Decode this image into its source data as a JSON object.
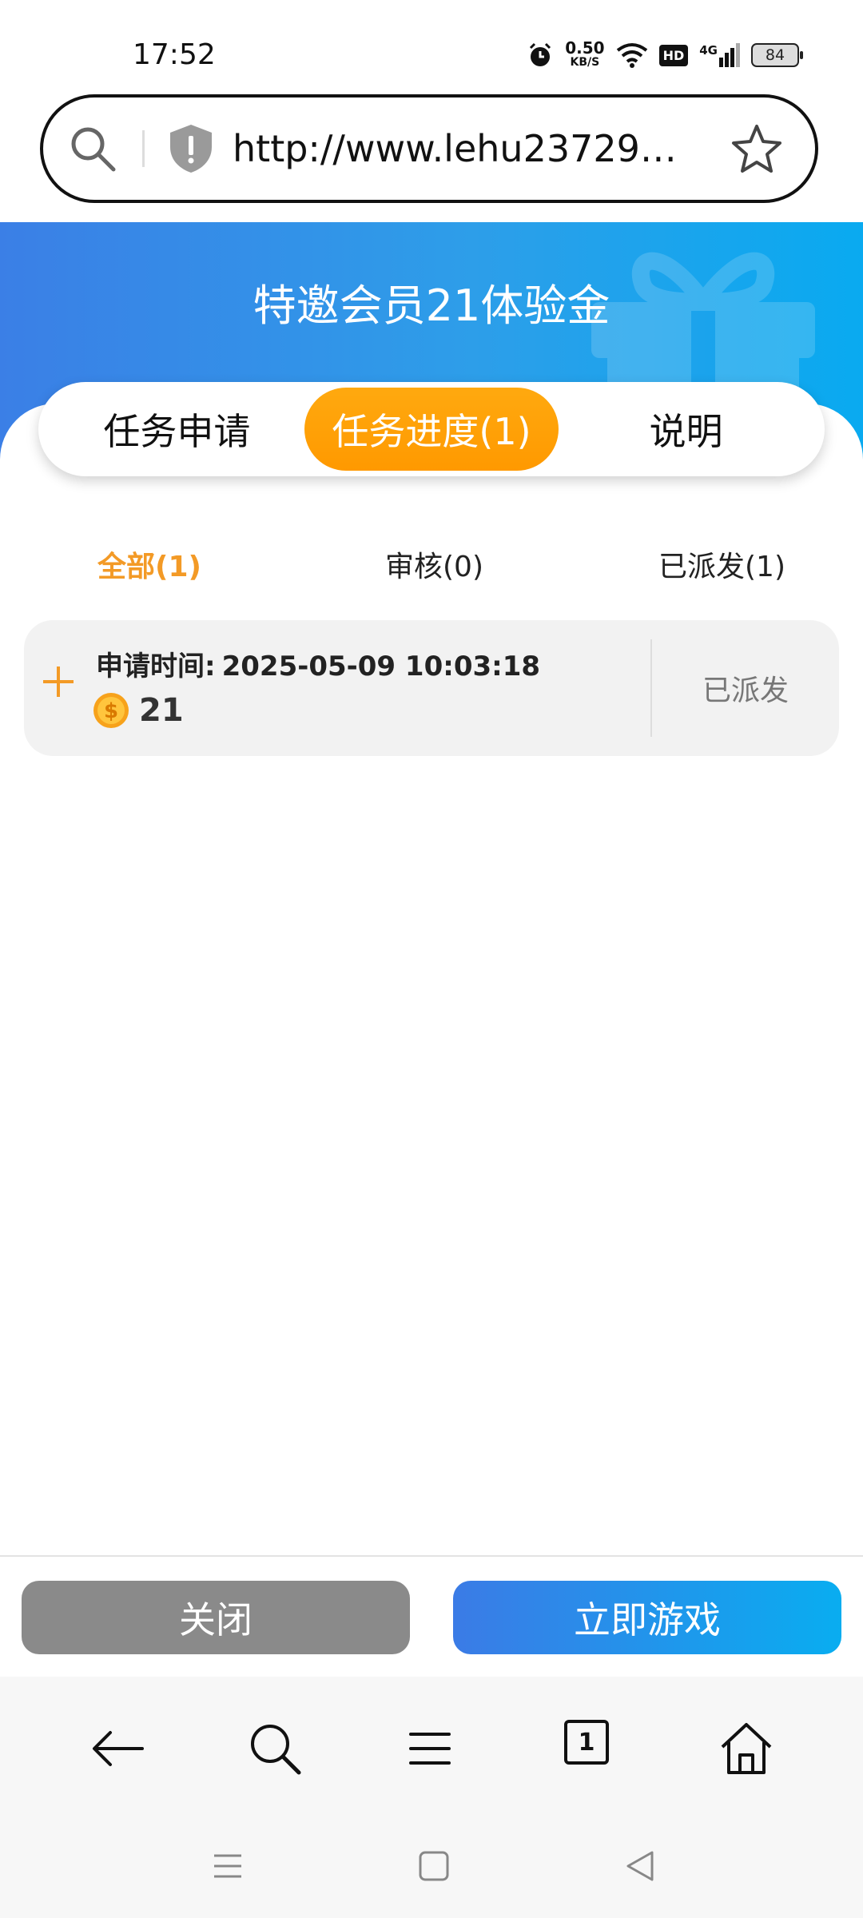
{
  "status_bar": {
    "time": "17:52",
    "net_speed": "0.50",
    "net_speed_unit": "KB/S",
    "hd_label": "HD",
    "network_type": "4G",
    "battery": "84"
  },
  "url_bar": {
    "url": "http://www.lehu2372954..."
  },
  "banner": {
    "title": "特邀会员21体验金"
  },
  "tabs": [
    {
      "label": "任务申请",
      "active": false
    },
    {
      "label": "任务进度(1)",
      "active": true
    },
    {
      "label": "说明",
      "active": false
    }
  ],
  "filters": [
    {
      "label": "全部(1)",
      "active": true
    },
    {
      "label": "审核(0)",
      "active": false
    },
    {
      "label": "已派发(1)",
      "active": false
    }
  ],
  "records": [
    {
      "time_label": "申请时间:",
      "time_value": "2025-05-09 10:03:18",
      "amount": "21",
      "status": "已派发"
    }
  ],
  "actions": {
    "close_label": "关闭",
    "play_label": "立即游戏"
  },
  "browser_nav": {
    "tab_count": "1"
  },
  "colors": {
    "accent_orange": "#ff9e0f",
    "banner_blue": "#2d8ee8",
    "button_gray": "#8a8a8a"
  }
}
